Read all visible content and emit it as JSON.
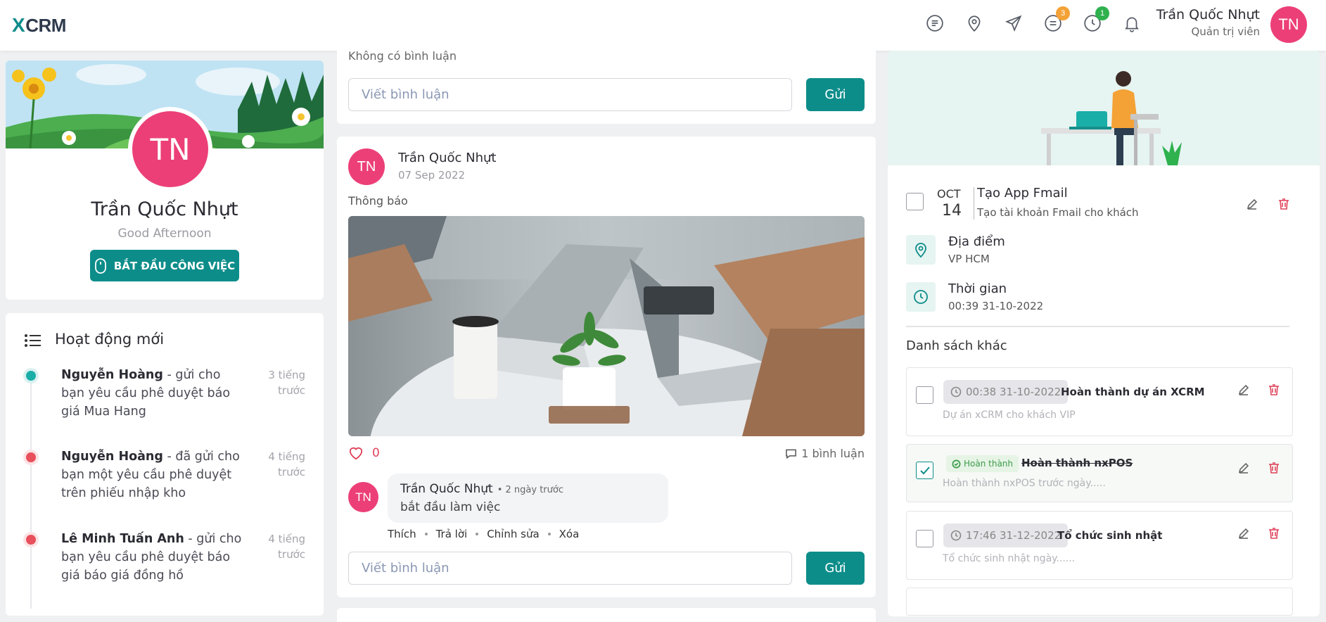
{
  "header": {
    "logo_x": "X",
    "logo_text": "CRM",
    "icons": [
      "note-icon",
      "location-pin-icon",
      "send-icon",
      "task-icon",
      "clock-icon",
      "bell-icon"
    ],
    "badge_task": "3",
    "badge_clock": "1",
    "user_name": "Trần Quốc Nhựt",
    "user_role": "Quản trị viên",
    "avatar_initials": "TN"
  },
  "profile": {
    "initials": "TN",
    "name": "Trần Quốc Nhựt",
    "greeting": "Good Afternoon",
    "start_button": "BẮT ĐẦU CÔNG VIỆC"
  },
  "activity": {
    "title": "Hoạt động mới",
    "items": [
      {
        "name": "Nguyễn Hoàng",
        "text": " - gửi cho bạn yêu cầu phê duyệt báo giá Mua Hang",
        "time": "3 tiếng trước",
        "dot_color": "#1aaea8"
      },
      {
        "name": "Nguyễn Hoàng",
        "text": " - đã gửi cho bạn một yêu cầu phê duyệt trên phiếu nhập kho",
        "time": "4 tiếng trước",
        "dot_color": "#e8505b"
      },
      {
        "name": "Lê Minh Tuấn Anh",
        "text": " - gửi cho bạn yêu cầu phê duyệt báo giá báo giá đồng hồ",
        "time": "4 tiếng trước",
        "dot_color": "#e8505b"
      }
    ]
  },
  "feed": {
    "top_card": {
      "no_comment": "Không có bình luận",
      "input_placeholder": "Viết bình luận",
      "send": "Gửi"
    },
    "post": {
      "author_initials": "TN",
      "author": "Trần Quốc Nhựt",
      "date": "07 Sep 2022",
      "text": "Thông báo",
      "likes": "0",
      "comment_count": "1 bình luận",
      "comment": {
        "initials": "TN",
        "author": "Trần Quốc Nhựt",
        "time": "• 2 ngày trước",
        "text": "bắt đầu làm việc",
        "actions": [
          "Thích",
          "Trả lời",
          "Chỉnh sửa",
          "Xóa"
        ]
      },
      "input_placeholder": "Viết bình luận",
      "send": "Gửi"
    }
  },
  "tasks": {
    "main": {
      "month": "OCT",
      "day": "14",
      "title": "Tạo App Fmail",
      "subtitle": "Tạo tài khoản Fmail cho khách",
      "location_label": "Địa điểm",
      "location_value": "VP HCM",
      "time_label": "Thời gian",
      "time_value": "00:39 31-10-2022"
    },
    "other_title": "Danh sách khác",
    "others": [
      {
        "time": "00:38 31-10-2022",
        "title": "Hoàn thành dự án XCRM",
        "subtitle": "Dự án xCRM cho khách VIP",
        "done": false
      },
      {
        "status": "Hoàn thành",
        "title": "Hoàn thành nxPOS",
        "subtitle": "Hoàn thành nxPOS trước ngày.....",
        "done": true
      },
      {
        "time": "17:46 31-12-2022",
        "title": "Tổ chức sinh nhật",
        "subtitle": "Tổ chức sinh nhật ngày......",
        "done": false
      }
    ]
  },
  "colors": {
    "accent": "#0d8d8a",
    "avatar": "#ec3f78",
    "danger": "#e0435a",
    "badge_orange": "#f4a236",
    "badge_green": "#2fb14e"
  }
}
